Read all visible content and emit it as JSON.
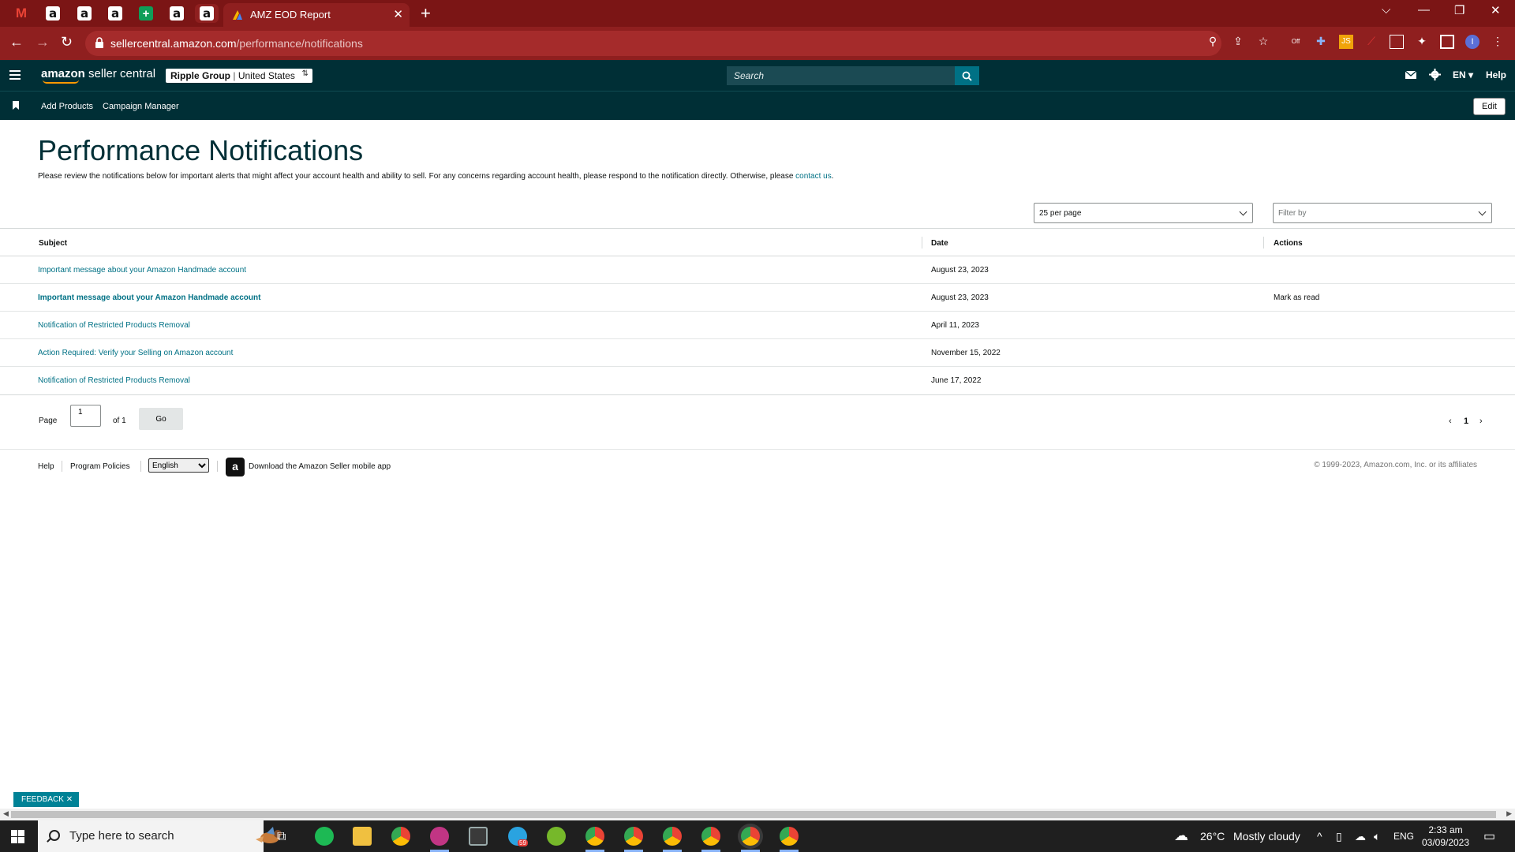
{
  "browser": {
    "active_tab_title": "AMZ EOD Report",
    "url_host": "sellercentral.amazon.com",
    "url_path": "/performance/notifications",
    "extension_badge": "Off",
    "profile_initial": "I",
    "colors": {
      "tabbar": "#7b1515",
      "toolbar": "#8f1f1f"
    }
  },
  "header": {
    "logo_bold": "amazon",
    "logo_light": " seller central",
    "account_name": "Ripple Group",
    "account_region": "United States",
    "search_placeholder": "Search",
    "language": "EN",
    "help": "Help"
  },
  "subnav": {
    "links": [
      "Add Products",
      "Campaign Manager"
    ],
    "edit": "Edit"
  },
  "page": {
    "title": "Performance Notifications",
    "description": "Please review the notifications below for important alerts that might affect your account health and ability to sell. For any concerns regarding account health, please respond to the notification directly. Otherwise, please ",
    "contact_link": "contact us",
    "description_end": "."
  },
  "controls": {
    "per_page": "25 per page",
    "filter_placeholder": "Filter by"
  },
  "table": {
    "headers": [
      "Subject",
      "Date",
      "Actions"
    ],
    "rows": [
      {
        "subject": "Important message about your Amazon Handmade account",
        "date": "August 23, 2023",
        "action": "",
        "unread": false
      },
      {
        "subject": "Important message about your Amazon Handmade account",
        "date": "August 23, 2023",
        "action": "Mark as read",
        "unread": true
      },
      {
        "subject": "Notification of Restricted Products Removal",
        "date": "April 11, 2023",
        "action": "",
        "unread": false
      },
      {
        "subject": "Action Required: Verify your Selling on Amazon account",
        "date": "November 15, 2022",
        "action": "",
        "unread": false
      },
      {
        "subject": "Notification of Restricted Products Removal",
        "date": "June 17, 2022",
        "action": "",
        "unread": false
      }
    ]
  },
  "pagination": {
    "page_label": "Page",
    "page_value": "1",
    "of_label": "of 1",
    "go": "Go",
    "current": "1"
  },
  "footer": {
    "help": "Help",
    "policies": "Program Policies",
    "language_options": [
      "English"
    ],
    "app_text": "Download the Amazon Seller mobile app",
    "copyright": "© 1999-2023, Amazon.com, Inc. or its affiliates"
  },
  "feedback": "FEEDBACK",
  "taskbar": {
    "search_placeholder": "Type here to search",
    "temperature": "26°C",
    "weather": "Mostly cloudy",
    "lang": "ENG",
    "time": "2:33 am",
    "date": "03/09/2023",
    "telegram_badge": "59"
  }
}
